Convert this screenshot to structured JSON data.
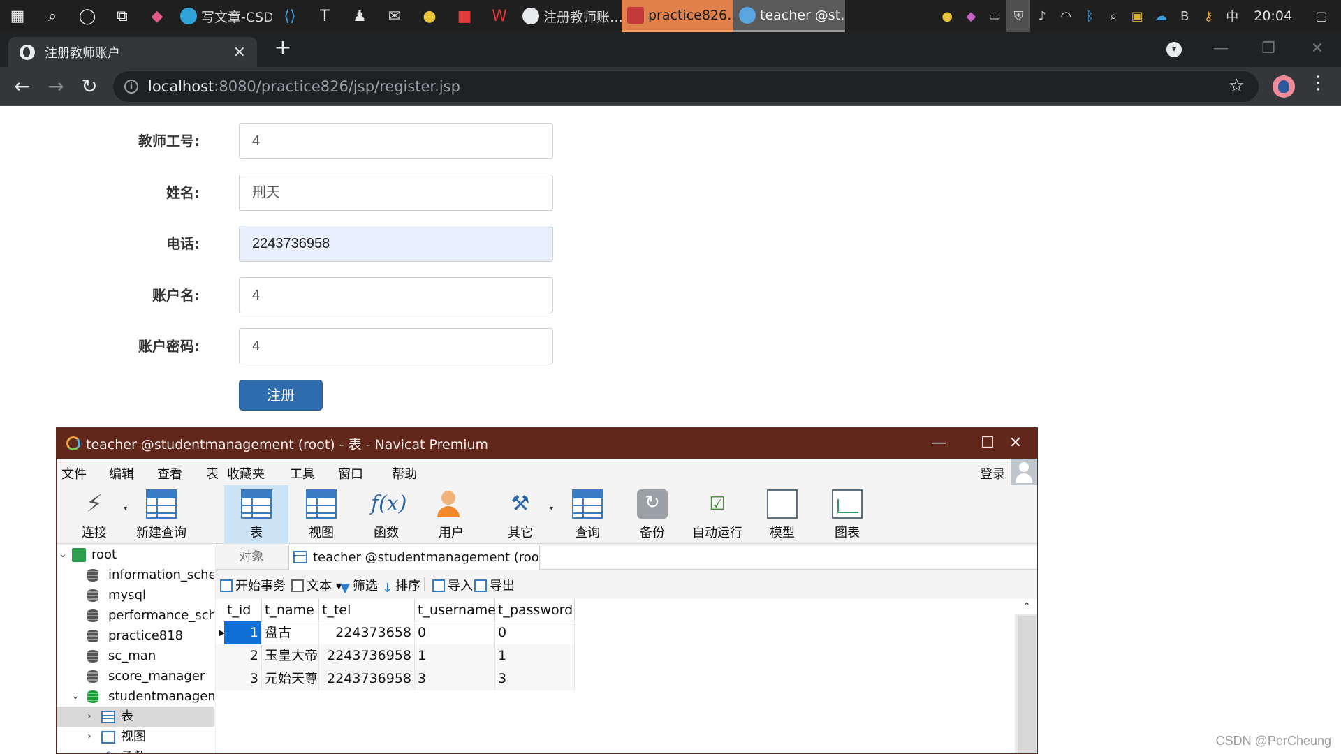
{
  "taskbar": {
    "apps": [
      {
        "label": "写文章-CSD…",
        "color": "#2fa3d8"
      },
      {
        "label": "注册教师账…",
        "color": "#e8eaed"
      },
      {
        "label": "practice826…",
        "color": "#c23a3a"
      },
      {
        "label": "teacher @st…",
        "color": "#5aa6e0"
      }
    ],
    "clock": "20:04"
  },
  "browser": {
    "tab_title": "注册教师账户",
    "url_host": "localhost",
    "url_path": ":8080/practice826/jsp/register.jsp"
  },
  "form": {
    "fields": [
      {
        "label": "教师工号:",
        "value": "4"
      },
      {
        "label": "姓名:",
        "value": "刑天"
      },
      {
        "label": "电话:",
        "value": "2243736958"
      },
      {
        "label": "账户名:",
        "value": "4"
      },
      {
        "label": "账户密码:",
        "value": "4"
      }
    ],
    "submit_label": "注册"
  },
  "navicat": {
    "title": "teacher @studentmanagement (root) - 表 - Navicat Premium",
    "menu": [
      "文件",
      "编辑",
      "查看",
      "表",
      "收藏夹",
      "工具",
      "窗口",
      "帮助"
    ],
    "login": "登录",
    "ribbon": [
      "连接",
      "新建查询",
      "表",
      "视图",
      "函数",
      "用户",
      "其它",
      "查询",
      "备份",
      "自动运行",
      "模型",
      "图表"
    ],
    "tree": [
      "root",
      "information_scher",
      "mysql",
      "performance_sche",
      "practice818",
      "sc_man",
      "score_manager",
      "studentmanagem",
      "表",
      "视图",
      "函数"
    ],
    "object_tab": "对象",
    "doc_tab": "teacher @studentmanagement (roo…",
    "tools": [
      "开始事务",
      "文本",
      "筛选",
      "排序",
      "导入",
      "导出"
    ],
    "columns": [
      "t_id",
      "t_name",
      "t_tel",
      "t_username",
      "t_password"
    ],
    "rows": [
      [
        "1",
        "盘古",
        "224373658",
        "0",
        "0"
      ],
      [
        "2",
        "玉皇大帝",
        "2243736958",
        "1",
        "1"
      ],
      [
        "3",
        "元始天尊",
        "2243736958",
        "3",
        "3"
      ]
    ]
  },
  "watermark": "CSDN @PerCheung"
}
